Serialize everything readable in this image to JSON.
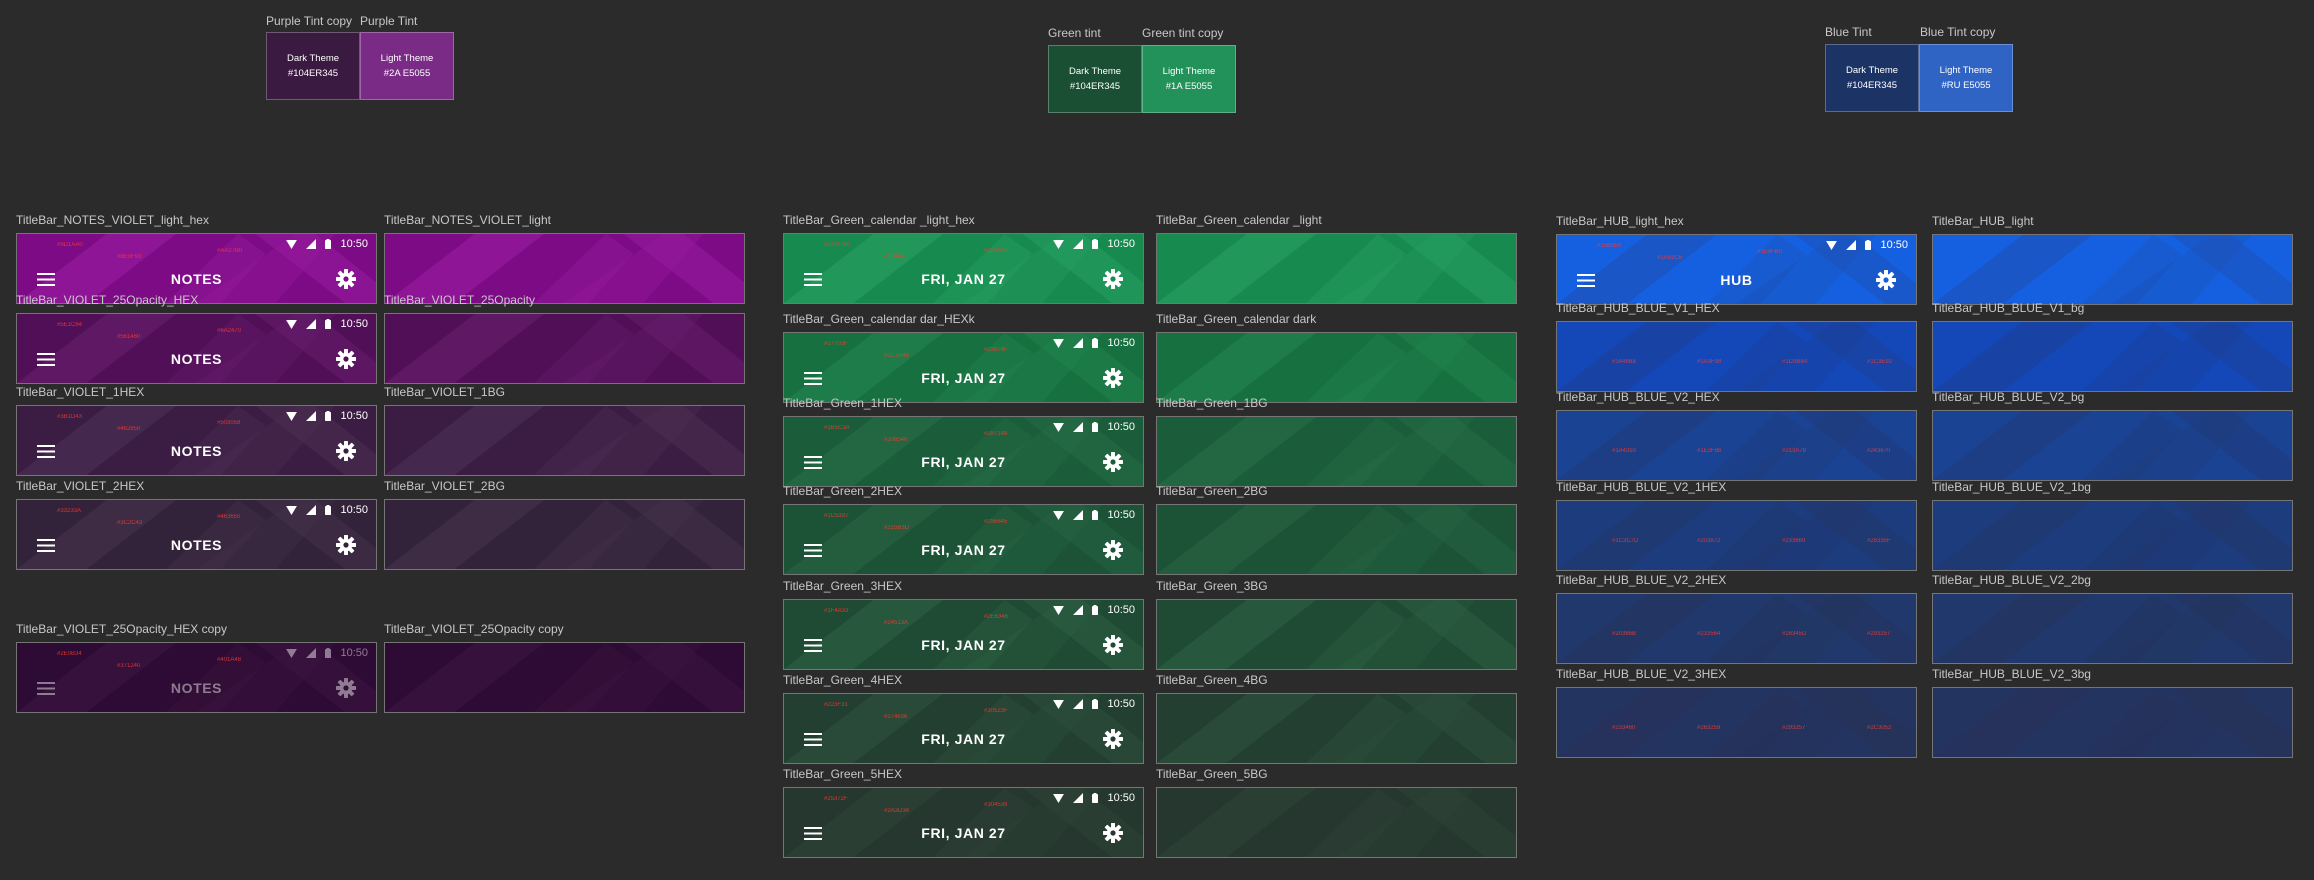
{
  "swatches": [
    {
      "group": "purple",
      "items": [
        {
          "name": "Purple Tint copy",
          "line1": "Dark Theme",
          "line2": "#104ER345",
          "color": "#3a1a40"
        },
        {
          "name": "Purple Tint",
          "line1": "Light Theme",
          "line2": "#2A E5055",
          "color": "#7a2b86"
        }
      ]
    },
    {
      "group": "green",
      "items": [
        {
          "name": "Green tint",
          "line1": "Dark Theme",
          "line2": "#104ER345",
          "color": "#1a4f33"
        },
        {
          "name": "Green tint copy",
          "line1": "Light Theme",
          "line2": "#1A E5055",
          "color": "#22925a"
        }
      ]
    },
    {
      "group": "blue",
      "items": [
        {
          "name": "Blue Tint",
          "line1": "Dark Theme",
          "line2": "#104ER345",
          "color": "#1c3366"
        },
        {
          "name": "Blue Tint copy",
          "line1": "Light Theme",
          "line2": "#RU E5055",
          "color": "#2f63c4"
        }
      ]
    }
  ],
  "bars": [
    {
      "label": "TitleBar_NOTES_VIOLET_light_hex",
      "bg": "#7d0b85",
      "accent": "#9c1fa3",
      "title": "NOTES",
      "time": "10:50",
      "ui": true,
      "hex": [
        "#9D1AA0",
        "#8E0F93",
        "#AA27B0"
      ]
    },
    {
      "label": "TitleBar_NOTES_VIOLET_light",
      "bg": "#7d0b85",
      "accent": "#9c1fa3",
      "ui": false
    },
    {
      "label": "TitleBar_VIOLET_25Opacity_HEX",
      "bg": "#510f57",
      "accent": "#6a2070",
      "title": "NOTES",
      "time": "10:50",
      "ui": true,
      "hex": [
        "#5E1C64",
        "#561460",
        "#6A2470"
      ]
    },
    {
      "label": "TitleBar_VIOLET_25Opacity",
      "bg": "#510f57",
      "accent": "#6a2070",
      "ui": false
    },
    {
      "label": "TitleBar_VIOLET_1HEX",
      "bg": "#3b1d43",
      "accent": "#4e3255",
      "title": "NOTES",
      "time": "10:50",
      "ui": true,
      "hex": [
        "#3B1D43",
        "#462850",
        "#503058"
      ]
    },
    {
      "label": "TitleBar_VIOLET_1BG",
      "bg": "#3b1d43",
      "accent": "#4e3255",
      "ui": false
    },
    {
      "label": "TitleBar_VIOLET_2HEX",
      "bg": "#33233a",
      "accent": "#45344c",
      "title": "NOTES",
      "time": "10:50",
      "ui": true,
      "hex": [
        "#33233A",
        "#3C2C43",
        "#463650"
      ]
    },
    {
      "label": "TitleBar_VIOLET_2BG",
      "bg": "#33233a",
      "accent": "#45344c",
      "ui": false
    },
    {
      "label": "TitleBar_VIOLET_25Opacity_HEX copy",
      "bg": "#2e0b34",
      "accent": "#3c1743",
      "title": "NOTES",
      "time": "10:50",
      "ui": true,
      "dim": true,
      "hex": [
        "#2E0B34",
        "#371240",
        "#401A48"
      ]
    },
    {
      "label": "TitleBar_VIOLET_25Opacity copy",
      "bg": "#2e0b34",
      "accent": "#3c1743",
      "ui": false
    },
    {
      "label": "TitleBar_Green_calendar _light_hex",
      "bg": "#178a4f",
      "accent": "#2aa265",
      "title": "FRI, JAN 27",
      "time": "10:50",
      "ui": true,
      "hex": [
        "#1A9F5B",
        "#158A4F",
        "#22A565"
      ]
    },
    {
      "label": "TitleBar_Green_calendar _light",
      "bg": "#178a4f",
      "accent": "#2aa265",
      "ui": false
    },
    {
      "label": "TitleBar_Green_calendar dar_HEXk",
      "bg": "#17703f",
      "accent": "#238752",
      "title": "FRI, JAN 27",
      "time": "10:50",
      "ui": true,
      "hex": [
        "#17703F",
        "#1C7A46",
        "#23874F"
      ]
    },
    {
      "label": "TitleBar_Green_calendar dark",
      "bg": "#17703f",
      "accent": "#238752",
      "ui": false
    },
    {
      "label": "TitleBar_Green_1HEX",
      "bg": "#1b5c3a",
      "accent": "#287148",
      "title": "FRI, JAN 27",
      "time": "10:50",
      "ui": true,
      "hex": [
        "#1B5C3A",
        "#206540",
        "#287148"
      ]
    },
    {
      "label": "TitleBar_Green_1BG",
      "bg": "#1b5c3a",
      "accent": "#287148",
      "ui": false
    },
    {
      "label": "TitleBar_Green_2HEX",
      "bg": "#1c5337",
      "accent": "#296645",
      "title": "FRI, JAN 27",
      "time": "10:50",
      "ui": true,
      "hex": [
        "#1C5337",
        "#215B3D",
        "#296645"
      ]
    },
    {
      "label": "TitleBar_Green_2BG",
      "bg": "#1c5337",
      "accent": "#296645",
      "ui": false
    },
    {
      "label": "TitleBar_Green_3HEX",
      "bg": "#1f4a33",
      "accent": "#2e6346",
      "title": "FRI, JAN 27",
      "time": "10:50",
      "ui": true,
      "hex": [
        "#1F4A33",
        "#24513A",
        "#2E6346"
      ]
    },
    {
      "label": "TitleBar_Green_3BG",
      "bg": "#1f4a33",
      "accent": "#2e6346",
      "ui": false
    },
    {
      "label": "TitleBar_Green_4HEX",
      "bg": "#223f31",
      "accent": "#30523f",
      "title": "FRI, JAN 27",
      "time": "10:50",
      "ui": true,
      "hex": [
        "#223F31",
        "#274636",
        "#30523F"
      ]
    },
    {
      "label": "TitleBar_Green_4BG",
      "bg": "#223f31",
      "accent": "#30523f",
      "ui": false
    },
    {
      "label": "TitleBar_Green_5HEX",
      "bg": "#25372f",
      "accent": "#304539",
      "title": "FRI, JAN 27",
      "time": "10:50",
      "ui": true,
      "hex": [
        "#25372F",
        "#2A3D34",
        "#304539"
      ]
    },
    {
      "label": "TitleBar_Green_5BG",
      "bg": "#25372f",
      "accent": "#304539",
      "ui": false
    },
    {
      "label": "TitleBar_HUB_light_hex",
      "bg": "#1560e0",
      "accent": "#1f4fb0",
      "title": "HUB",
      "time": "10:50",
      "ui": true,
      "hex": [
        "#1560E0",
        "#1A53C6",
        "#1E4FB0"
      ]
    },
    {
      "label": "TitleBar_HUB_light",
      "bg": "#1560e0",
      "accent": "#1f4fb0",
      "ui": false
    },
    {
      "label": "TitleBar_HUB_BLUE_V1_HEX",
      "bg": "#1448b8",
      "accent": "#1c3e92",
      "ui": false,
      "hexOnly": true,
      "hex": [
        "#1448B8",
        "#1A3F98",
        "#1D3B8A",
        "#1C3E92"
      ]
    },
    {
      "label": "TitleBar_HUB_BLUE_V1_bg",
      "bg": "#1448b8",
      "accent": "#1c3e92",
      "ui": false
    },
    {
      "label": "TitleBar_HUB_BLUE_V2_HEX",
      "bg": "#1a4393",
      "accent": "#213a78",
      "ui": false,
      "hexOnly": true,
      "hex": [
        "#1A4393",
        "#1E3F86",
        "#213A78",
        "#243670"
      ]
    },
    {
      "label": "TitleBar_HUB_BLUE_V2_bg",
      "bg": "#1a4393",
      "accent": "#213a78",
      "ui": false
    },
    {
      "label": "TitleBar_HUB_BLUE_V2_1HEX",
      "bg": "#1c3c7d",
      "accent": "#233669",
      "ui": false,
      "hexOnly": true,
      "hex": [
        "#1C3C7D",
        "#203872",
        "#233669",
        "#26335F"
      ]
    },
    {
      "label": "TitleBar_HUB_BLUE_V2_1bg",
      "bg": "#1c3c7d",
      "accent": "#233669",
      "ui": false
    },
    {
      "label": "TitleBar_HUB_BLUE_V2_2HEX",
      "bg": "#20386b",
      "accent": "#26345d",
      "ui": false,
      "hexOnly": true,
      "hex": [
        "#20386B",
        "#233564",
        "#26345D",
        "#293257"
      ]
    },
    {
      "label": "TitleBar_HUB_BLUE_V2_2bg",
      "bg": "#20386b",
      "accent": "#26345d",
      "ui": false
    },
    {
      "label": "TitleBar_HUB_BLUE_V2_3HEX",
      "bg": "#233460",
      "accent": "#293257",
      "ui": false,
      "hexOnly": true,
      "hex": [
        "#233460",
        "#263259",
        "#293257",
        "#2C3052"
      ]
    },
    {
      "label": "TitleBar_HUB_BLUE_V2_3bg",
      "bg": "#233460",
      "accent": "#293257",
      "ui": false
    }
  ]
}
